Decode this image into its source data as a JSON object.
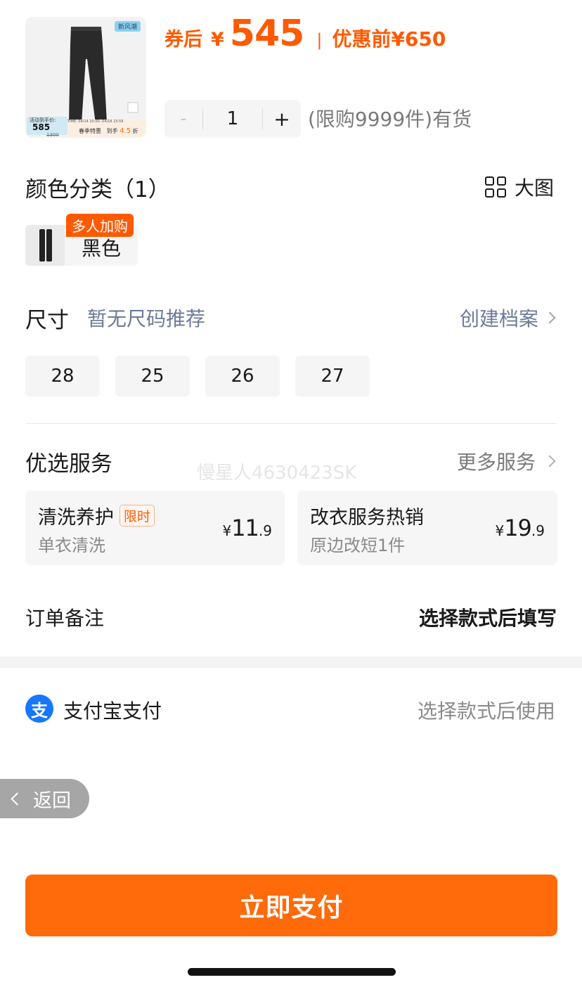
{
  "product": {
    "image_badge": "新风潮",
    "image_price_label": "活动到手价:",
    "image_price": "585",
    "image_orig_price": "1300",
    "image_date_range": "TIME: 04/14 20:00- 04/18 23:59",
    "image_promo": "春季特惠",
    "image_discount_prefix": "到手",
    "image_discount": "4.5",
    "image_discount_suffix": "折",
    "price_label": "券后",
    "currency": "¥",
    "price": "545",
    "separator": "|",
    "pre_discount_label": "优惠前",
    "pre_discount_price": "¥650"
  },
  "quantity": {
    "minus": "-",
    "value": "1",
    "plus": "+",
    "limit_text": "(限购9999件)有货"
  },
  "color_section": {
    "title": "颜色分类（1）",
    "big_image_label": "大图",
    "option_label": "黑色",
    "option_tag": "多人加购"
  },
  "size_section": {
    "title": "尺寸",
    "hint": "暂无尺码推荐",
    "create_profile": "创建档案",
    "sizes": [
      "28",
      "25",
      "26",
      "27"
    ]
  },
  "services": {
    "title": "优选服务",
    "more": "更多服务",
    "watermark": "慢星人4630423SK",
    "cards": [
      {
        "title": "清洗养护",
        "tag": "限时",
        "subtitle": "单衣清洗",
        "yen": "¥",
        "price_int": "11",
        "price_dec": ".9"
      },
      {
        "title": "改衣服务热销",
        "tag": "",
        "subtitle": "原边改短1件",
        "yen": "¥",
        "price_int": "19",
        "price_dec": ".9"
      }
    ]
  },
  "order_note": {
    "label": "订单备注",
    "value": "选择款式后填写"
  },
  "payment": {
    "method_icon": "支",
    "method": "支付宝支付",
    "status": "选择款式后使用"
  },
  "back_label": "返回",
  "pay_button": "立即支付",
  "colors": {
    "accent": "#ff5a00",
    "pay_button": "#ff6a0a",
    "alipay": "#1677ff",
    "link": "#6d7a99"
  }
}
